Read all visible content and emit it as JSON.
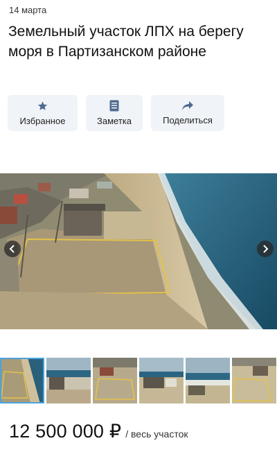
{
  "listing": {
    "date": "14 марта",
    "title": "Земельный участок ЛПХ на берегу моря в Партизанском районе",
    "price": "12 500 000 ₽",
    "price_unit": "/ весь участок"
  },
  "actions": {
    "favorite_label": "Избранное",
    "note_label": "Заметка",
    "share_label": "Поделиться"
  },
  "gallery": {
    "thumbnail_count": 6,
    "active_index": 0
  },
  "icons": {
    "favorite": "star-icon",
    "note": "note-icon",
    "share": "share-icon",
    "prev": "chevron-left-icon",
    "next": "chevron-right-icon"
  },
  "colors": {
    "action_bg": "#f0f3f7",
    "icon": "#4f6a8f",
    "thumb_active": "#4aa3df",
    "sea": "#1f5570",
    "sand": "#cbb98f"
  }
}
